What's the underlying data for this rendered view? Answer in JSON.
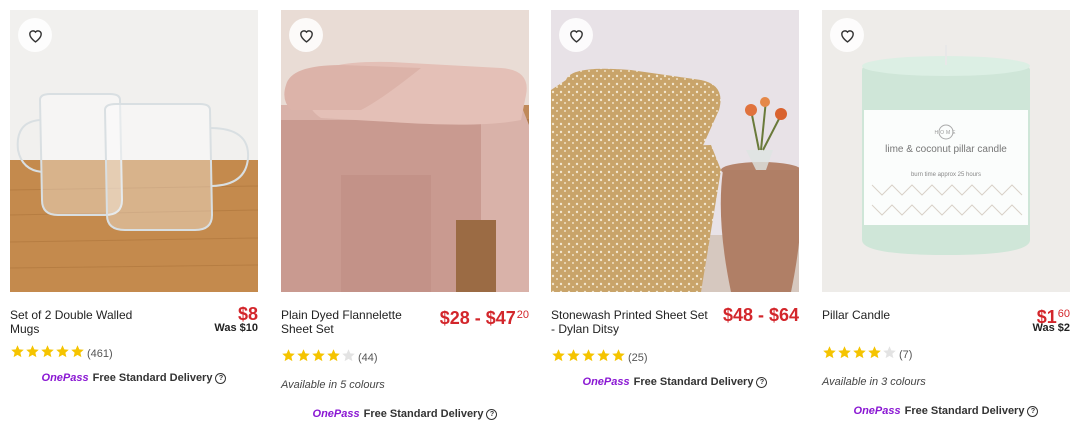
{
  "products": [
    {
      "title": "Set of 2 Double Walled Mugs",
      "price_main": "$8",
      "price_cents": "",
      "was": "Was $10",
      "rating": 5,
      "reviews": "(461)",
      "colours": "",
      "delivery_brand": "OnePass",
      "delivery_text": "Free Standard Delivery"
    },
    {
      "title": "Plain Dyed Flannelette Sheet Set",
      "price_main": "$28 - $47",
      "price_cents": "20",
      "was": "",
      "rating": 4,
      "reviews": "(44)",
      "colours": "Available in 5 colours",
      "delivery_brand": "OnePass",
      "delivery_text": "Free Standard Delivery"
    },
    {
      "title": "Stonewash Printed Sheet Set - Dylan Ditsy",
      "price_main": "$48 - $64",
      "price_cents": "",
      "was": "",
      "rating": 5,
      "reviews": "(25)",
      "colours": "",
      "delivery_brand": "OnePass",
      "delivery_text": "Free Standard Delivery"
    },
    {
      "title": "Pillar Candle",
      "price_main": "$1",
      "price_cents": "60",
      "was": "Was $2",
      "rating": 4,
      "reviews": "(7)",
      "colours": "Available in 3 colours",
      "delivery_brand": "OnePass",
      "delivery_text": "Free Standard Delivery",
      "candle_label_line1": "lime & coconut pillar candle",
      "candle_label_line2": "burn time approx 25 hours",
      "candle_brand": "HOME"
    }
  ],
  "colors": {
    "price": "#d3262b",
    "star": "#f5c400",
    "onepass": "#8a17d3"
  }
}
